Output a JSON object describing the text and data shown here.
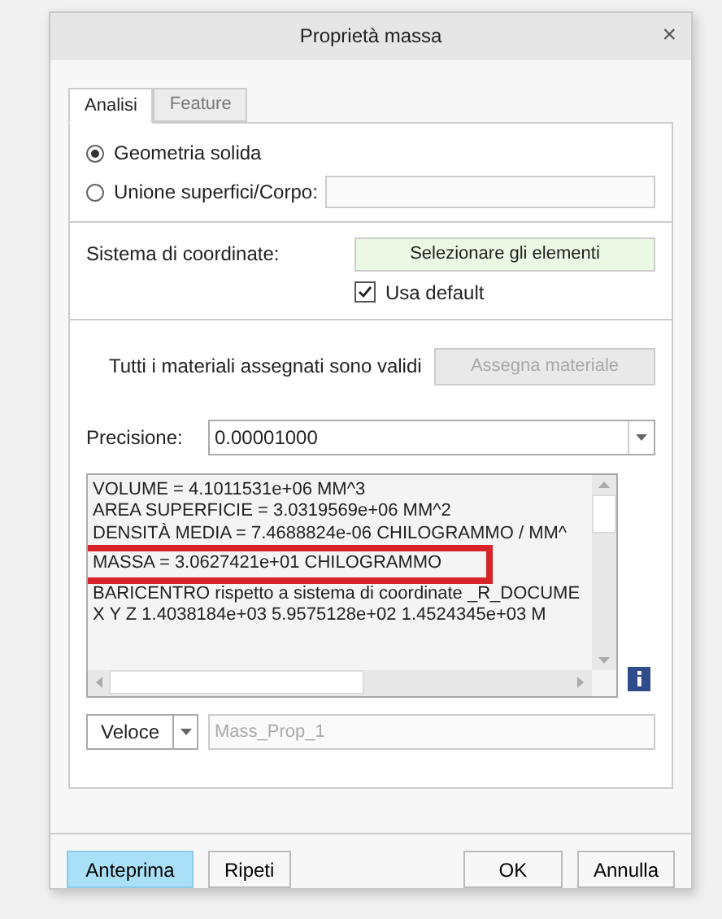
{
  "window": {
    "title": "Proprietà massa",
    "close": "×"
  },
  "tabs": [
    {
      "label": "Analisi",
      "selected": true
    },
    {
      "label": "Feature",
      "selected": false
    }
  ],
  "geometry_options": [
    {
      "label": "Geometria solida",
      "selected": true
    },
    {
      "label": "Unione superfici/Corpo:",
      "selected": false
    }
  ],
  "coordinate_system": {
    "label": "Sistema di coordinate:",
    "selector": "Selezionare gli elementi",
    "use_default": {
      "label": "Usa default",
      "checked": true
    }
  },
  "materials": {
    "message": "Tutti i materiali assegnati sono validi",
    "button": {
      "label": "Assegna materiale",
      "disabled": true
    }
  },
  "precision": {
    "label": "Precisione:",
    "value": "0.00001000"
  },
  "results": {
    "lines": [
      {
        "text": "VOLUME =  4.1011531e+06  MM^3"
      },
      {
        "text": "AREA SUPERFICIE =  3.0319569e+06  MM^2"
      },
      {
        "text": "DENSITÀ MEDIA =  7.4688824e-06  CHILOGRAMMO / MM^"
      },
      {
        "text": "MASSA =  3.0627421e+01 CHILOGRAMMO",
        "highlighted": true
      },
      {
        "text": "BARICENTRO rispetto a sistema di coordinate _R_DOCUME"
      },
      {
        "text": "X   Y   Z    1.4038184e+03  5.9575128e+02  1.4524345e+03  M"
      }
    ]
  },
  "mode": {
    "value": "Veloce",
    "name_placeholder": "Mass_Prop_1"
  },
  "buttons": [
    {
      "label": "Anteprima",
      "primary": true
    },
    {
      "label": "Ripeti",
      "primary": false
    },
    {
      "label": "OK",
      "primary": false
    },
    {
      "label": "Annulla",
      "primary": false
    }
  ]
}
